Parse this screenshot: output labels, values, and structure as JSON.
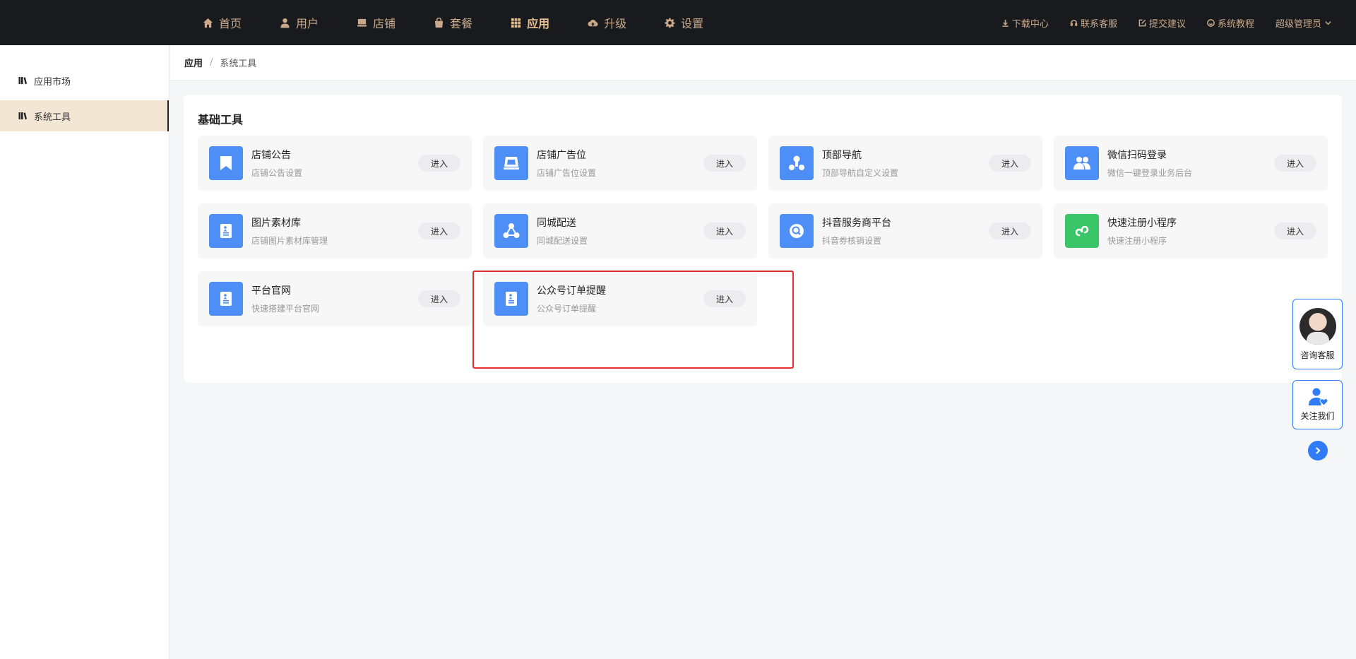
{
  "nav": {
    "items": [
      {
        "label": "首页",
        "icon": "home-icon"
      },
      {
        "label": "用户",
        "icon": "user-icon"
      },
      {
        "label": "店铺",
        "icon": "shop-icon"
      },
      {
        "label": "套餐",
        "icon": "bag-icon"
      },
      {
        "label": "应用",
        "icon": "grid-icon",
        "active": true
      },
      {
        "label": "升级",
        "icon": "cloud-upload-icon"
      },
      {
        "label": "设置",
        "icon": "gear-icon"
      }
    ],
    "right": [
      {
        "label": "下载中心",
        "icon": "download-icon"
      },
      {
        "label": "联系客服",
        "icon": "headset-icon"
      },
      {
        "label": "提交建议",
        "icon": "edit-icon"
      },
      {
        "label": "系统教程",
        "icon": "smile-icon"
      }
    ],
    "admin_label": "超级管理员"
  },
  "sidebar": {
    "items": [
      {
        "label": "应用市场"
      },
      {
        "label": "系统工具",
        "active": true
      }
    ]
  },
  "breadcrumb": {
    "root": "应用",
    "separator": "/",
    "current": "系统工具"
  },
  "section_title": "基础工具",
  "tools": [
    {
      "name": "店铺公告",
      "desc": "店铺公告设置",
      "button": "进入",
      "icon": "bookmark-icon",
      "color": "#4d8ef7"
    },
    {
      "name": "店铺广告位",
      "desc": "店铺广告位设置",
      "button": "进入",
      "icon": "billboard-icon",
      "color": "#4d8ef7"
    },
    {
      "name": "顶部导航",
      "desc": "顶部导航自定义设置",
      "button": "进入",
      "icon": "network-icon",
      "color": "#4d8ef7"
    },
    {
      "name": "微信扫码登录",
      "desc": "微信一键登录业务后台",
      "button": "进入",
      "icon": "users-icon",
      "color": "#4d8ef7"
    },
    {
      "name": "图片素材库",
      "desc": "店铺图片素材库管理",
      "button": "进入",
      "icon": "document-icon",
      "color": "#4d8ef7"
    },
    {
      "name": "同城配送",
      "desc": "同城配送设置",
      "button": "进入",
      "icon": "share-nodes-icon",
      "color": "#4d8ef7"
    },
    {
      "name": "抖音服务商平台",
      "desc": "抖音券核销设置",
      "button": "进入",
      "icon": "scan-icon",
      "color": "#4d8ef7"
    },
    {
      "name": "快速注册小程序",
      "desc": "快速注册小程序",
      "button": "进入",
      "icon": "mini-program-icon",
      "color": "#3ac569"
    },
    {
      "name": "平台官网",
      "desc": "快速搭建平台官网",
      "button": "进入",
      "icon": "document-icon",
      "color": "#4d8ef7"
    },
    {
      "name": "公众号订单提醒",
      "desc": "公众号订单提醒",
      "button": "进入",
      "icon": "document-icon",
      "color": "#4d8ef7"
    }
  ],
  "floating": {
    "consult_label": "咨询客服",
    "follow_label": "关注我们"
  },
  "colors": {
    "topbar_bg": "#191a1d",
    "nav_text": "#c9a98a",
    "sidebar_active_bg": "#f4e6d5",
    "tool_icon_blue": "#4d8ef7",
    "tool_icon_green": "#3ac569",
    "highlight_border": "#e52d2d",
    "float_accent": "#2f7cf6"
  }
}
